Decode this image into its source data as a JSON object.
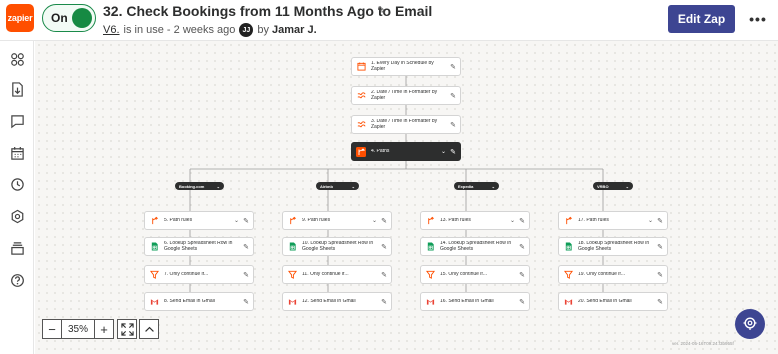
{
  "header": {
    "logo_text": "zapier",
    "toggle_label": "On",
    "title": "32. Check Bookings from 11 Months Ago to Email",
    "version": "V6.",
    "status": "is in use - 2 weeks ago",
    "avatar_initials": "JJ",
    "by": "by",
    "author": "Jamar J.",
    "edit_label": "Edit Zap",
    "more_label": "•••"
  },
  "sidebar": {
    "items": [
      "apps-icon",
      "import-icon",
      "comment-icon",
      "calendar-icon",
      "history-icon",
      "settings-icon",
      "layers-icon",
      "help-icon"
    ]
  },
  "steps": {
    "s1": "1. Every Day in Schedule by Zapier",
    "s2": "2. Date / Time in Formatter by Zapier",
    "s3": "3. Date / Time in Formatter by Zapier",
    "s4": "4. Paths"
  },
  "branches": [
    {
      "name": "Booking.com",
      "steps": [
        "5. Path rules",
        "6. Lookup Spreadsheet Row in Google Sheets",
        "7. Only continue if...",
        "8. Send Email in Gmail"
      ]
    },
    {
      "name": "Airbnb",
      "steps": [
        "9. Path rules",
        "10. Lookup Spreadsheet Row in Google Sheets",
        "11. Only continue if...",
        "12. Send Email in Gmail"
      ]
    },
    {
      "name": "Expedia",
      "steps": [
        "13. Path rules",
        "14. Lookup Spreadsheet Row in Google Sheets",
        "15. Only continue if...",
        "16. Send Email in Gmail"
      ]
    },
    {
      "name": "VRBO",
      "steps": [
        "17. Path rules",
        "18. Lookup Spreadsheet Row in Google Sheets",
        "19. Only continue if...",
        "20. Send Email in Gmail"
      ]
    }
  ],
  "controls": {
    "zoom_out": "−",
    "zoom_level": "35%",
    "zoom_in": "+"
  },
  "version_footer": "ver. 2024-05-16T09:24:f3b955f",
  "colors": {
    "brand": "#ff4f00",
    "primary": "#3d4592",
    "toggle_on": "#168a43"
  }
}
